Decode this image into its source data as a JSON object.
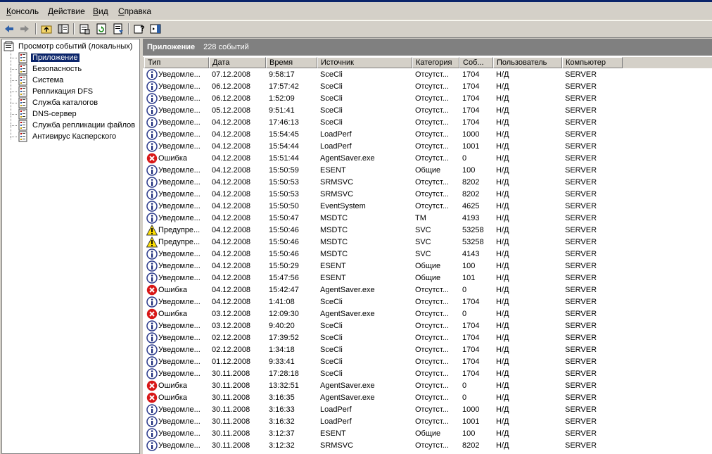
{
  "menu": [
    "Консоль",
    "Действие",
    "Вид",
    "Справка"
  ],
  "tree": {
    "root": "Просмотр событий (локальных)",
    "items": [
      {
        "label": "Приложение",
        "selected": true
      },
      {
        "label": "Безопасность"
      },
      {
        "label": "Система"
      },
      {
        "label": "Репликация DFS"
      },
      {
        "label": "Служба каталогов"
      },
      {
        "label": "DNS-сервер"
      },
      {
        "label": "Служба репликации файлов"
      },
      {
        "label": "Антивирус Касперского"
      }
    ]
  },
  "panel": {
    "title": "Приложение",
    "count": "228 событий"
  },
  "columns": [
    "Тип",
    "Дата",
    "Время",
    "Источник",
    "Категория",
    "Соб...",
    "Пользователь",
    "Компьютер"
  ],
  "rows": [
    [
      "info",
      "Уведомле...",
      "07.12.2008",
      "9:58:17",
      "SceCli",
      "Отсутст...",
      "1704",
      "Н/Д",
      "SERVER"
    ],
    [
      "info",
      "Уведомле...",
      "06.12.2008",
      "17:57:42",
      "SceCli",
      "Отсутст...",
      "1704",
      "Н/Д",
      "SERVER"
    ],
    [
      "info",
      "Уведомле...",
      "06.12.2008",
      "1:52:09",
      "SceCli",
      "Отсутст...",
      "1704",
      "Н/Д",
      "SERVER"
    ],
    [
      "info",
      "Уведомле...",
      "05.12.2008",
      "9:51:41",
      "SceCli",
      "Отсутст...",
      "1704",
      "Н/Д",
      "SERVER"
    ],
    [
      "info",
      "Уведомле...",
      "04.12.2008",
      "17:46:13",
      "SceCli",
      "Отсутст...",
      "1704",
      "Н/Д",
      "SERVER"
    ],
    [
      "info",
      "Уведомле...",
      "04.12.2008",
      "15:54:45",
      "LoadPerf",
      "Отсутст...",
      "1000",
      "Н/Д",
      "SERVER"
    ],
    [
      "info",
      "Уведомле...",
      "04.12.2008",
      "15:54:44",
      "LoadPerf",
      "Отсутст...",
      "1001",
      "Н/Д",
      "SERVER"
    ],
    [
      "error",
      "Ошибка",
      "04.12.2008",
      "15:51:44",
      "AgentSaver.exe",
      "Отсутст...",
      "0",
      "Н/Д",
      "SERVER"
    ],
    [
      "info",
      "Уведомле...",
      "04.12.2008",
      "15:50:59",
      "ESENT",
      "Общие",
      "100",
      "Н/Д",
      "SERVER"
    ],
    [
      "info",
      "Уведомле...",
      "04.12.2008",
      "15:50:53",
      "SRMSVC",
      "Отсутст...",
      "8202",
      "Н/Д",
      "SERVER"
    ],
    [
      "info",
      "Уведомле...",
      "04.12.2008",
      "15:50:53",
      "SRMSVC",
      "Отсутст...",
      "8202",
      "Н/Д",
      "SERVER"
    ],
    [
      "info",
      "Уведомле...",
      "04.12.2008",
      "15:50:50",
      "EventSystem",
      "Отсутст...",
      "4625",
      "Н/Д",
      "SERVER"
    ],
    [
      "info",
      "Уведомле...",
      "04.12.2008",
      "15:50:47",
      "MSDTC",
      "TM",
      "4193",
      "Н/Д",
      "SERVER"
    ],
    [
      "warning",
      "Предупре...",
      "04.12.2008",
      "15:50:46",
      "MSDTC",
      "SVC",
      "53258",
      "Н/Д",
      "SERVER"
    ],
    [
      "warning",
      "Предупре...",
      "04.12.2008",
      "15:50:46",
      "MSDTC",
      "SVC",
      "53258",
      "Н/Д",
      "SERVER"
    ],
    [
      "info",
      "Уведомле...",
      "04.12.2008",
      "15:50:46",
      "MSDTC",
      "SVC",
      "4143",
      "Н/Д",
      "SERVER"
    ],
    [
      "info",
      "Уведомле...",
      "04.12.2008",
      "15:50:29",
      "ESENT",
      "Общие",
      "100",
      "Н/Д",
      "SERVER"
    ],
    [
      "info",
      "Уведомле...",
      "04.12.2008",
      "15:47:56",
      "ESENT",
      "Общие",
      "101",
      "Н/Д",
      "SERVER"
    ],
    [
      "error",
      "Ошибка",
      "04.12.2008",
      "15:42:47",
      "AgentSaver.exe",
      "Отсутст...",
      "0",
      "Н/Д",
      "SERVER"
    ],
    [
      "info",
      "Уведомле...",
      "04.12.2008",
      "1:41:08",
      "SceCli",
      "Отсутст...",
      "1704",
      "Н/Д",
      "SERVER"
    ],
    [
      "error",
      "Ошибка",
      "03.12.2008",
      "12:09:30",
      "AgentSaver.exe",
      "Отсутст...",
      "0",
      "Н/Д",
      "SERVER"
    ],
    [
      "info",
      "Уведомле...",
      "03.12.2008",
      "9:40:20",
      "SceCli",
      "Отсутст...",
      "1704",
      "Н/Д",
      "SERVER"
    ],
    [
      "info",
      "Уведомле...",
      "02.12.2008",
      "17:39:52",
      "SceCli",
      "Отсутст...",
      "1704",
      "Н/Д",
      "SERVER"
    ],
    [
      "info",
      "Уведомле...",
      "02.12.2008",
      "1:34:18",
      "SceCli",
      "Отсутст...",
      "1704",
      "Н/Д",
      "SERVER"
    ],
    [
      "info",
      "Уведомле...",
      "01.12.2008",
      "9:33:41",
      "SceCli",
      "Отсутст...",
      "1704",
      "Н/Д",
      "SERVER"
    ],
    [
      "info",
      "Уведомле...",
      "30.11.2008",
      "17:28:18",
      "SceCli",
      "Отсутст...",
      "1704",
      "Н/Д",
      "SERVER"
    ],
    [
      "error",
      "Ошибка",
      "30.11.2008",
      "13:32:51",
      "AgentSaver.exe",
      "Отсутст...",
      "0",
      "Н/Д",
      "SERVER"
    ],
    [
      "error",
      "Ошибка",
      "30.11.2008",
      "3:16:35",
      "AgentSaver.exe",
      "Отсутст...",
      "0",
      "Н/Д",
      "SERVER"
    ],
    [
      "info",
      "Уведомле...",
      "30.11.2008",
      "3:16:33",
      "LoadPerf",
      "Отсутст...",
      "1000",
      "Н/Д",
      "SERVER"
    ],
    [
      "info",
      "Уведомле...",
      "30.11.2008",
      "3:16:32",
      "LoadPerf",
      "Отсутст...",
      "1001",
      "Н/Д",
      "SERVER"
    ],
    [
      "info",
      "Уведомле...",
      "30.11.2008",
      "3:12:37",
      "ESENT",
      "Общие",
      "100",
      "Н/Д",
      "SERVER"
    ],
    [
      "info",
      "Уведомле...",
      "30.11.2008",
      "3:12:32",
      "SRMSVC",
      "Отсутст...",
      "8202",
      "Н/Д",
      "SERVER"
    ]
  ],
  "icons": {
    "info": "information-icon",
    "error": "error-icon",
    "warning": "warning-icon",
    "selection_color": "#0a246a",
    "header_color": "#808080"
  }
}
